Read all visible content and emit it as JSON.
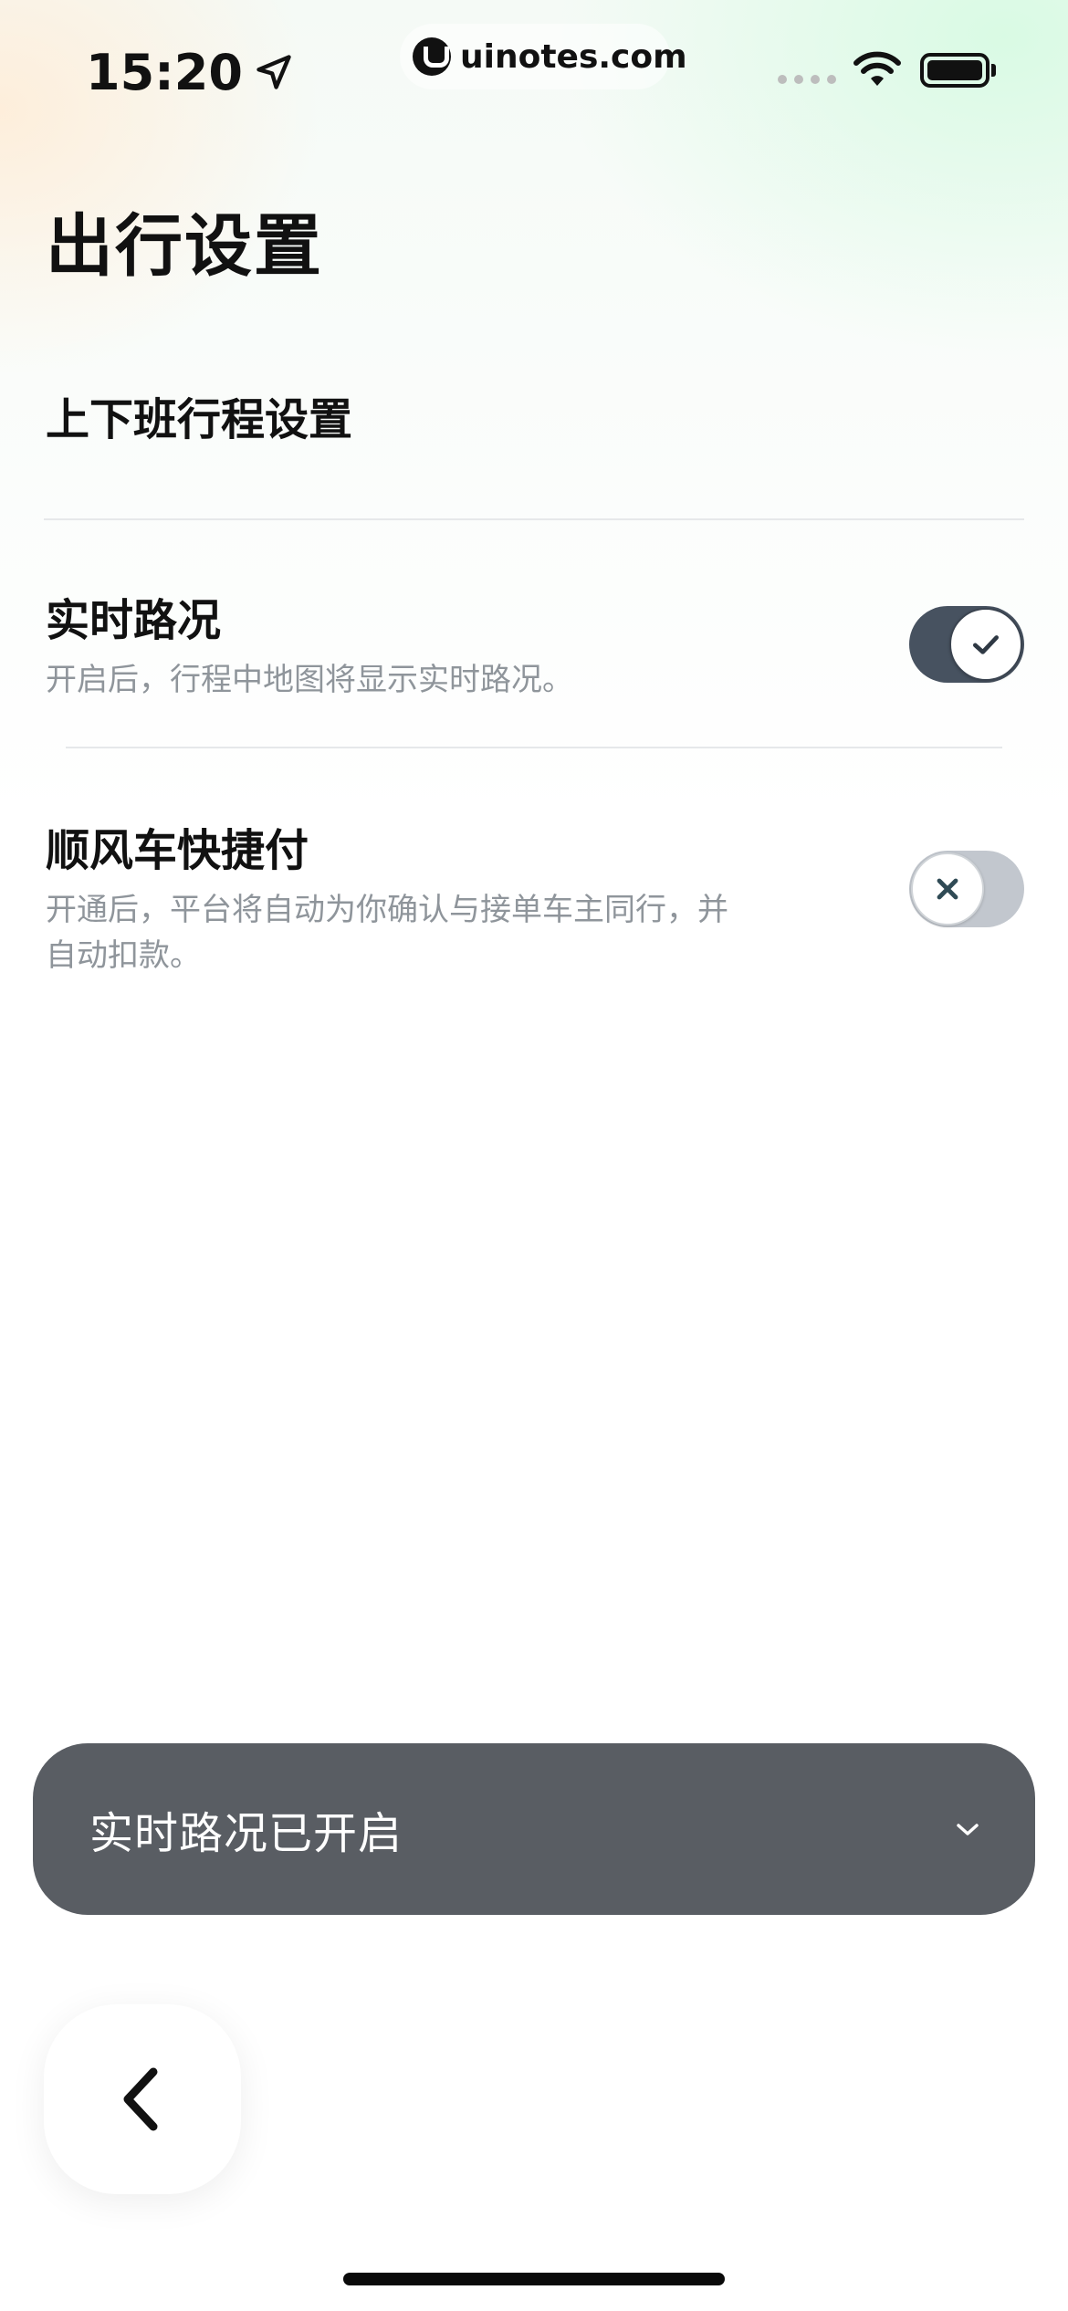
{
  "status_bar": {
    "time": "15:20",
    "url": "uinotes.com",
    "icons": [
      "location-arrow-icon",
      "signal-icon",
      "wifi-icon",
      "battery-icon"
    ]
  },
  "page": {
    "title": "出行设置"
  },
  "settings": {
    "commute": {
      "label": "上下班行程设置"
    },
    "traffic": {
      "title": "实时路况",
      "description": "开启后，行程中地图将显示实时路况。",
      "enabled": true
    },
    "quick_pay": {
      "title": "顺风车快捷付",
      "description_line1": "开通后，平台将自动为你确认与接单车主同行，并",
      "description_line2": "自动扣款。",
      "enabled": false
    }
  },
  "toast": {
    "message": "实时路况已开启",
    "icon": "chevron-down-icon"
  },
  "navigation": {
    "back_icon": "chevron-left-icon"
  },
  "colors": {
    "toggle_on": "#475260",
    "toggle_off": "#c2c7ce",
    "toast_bg": "#595d63",
    "desc_text": "#8f959b"
  }
}
